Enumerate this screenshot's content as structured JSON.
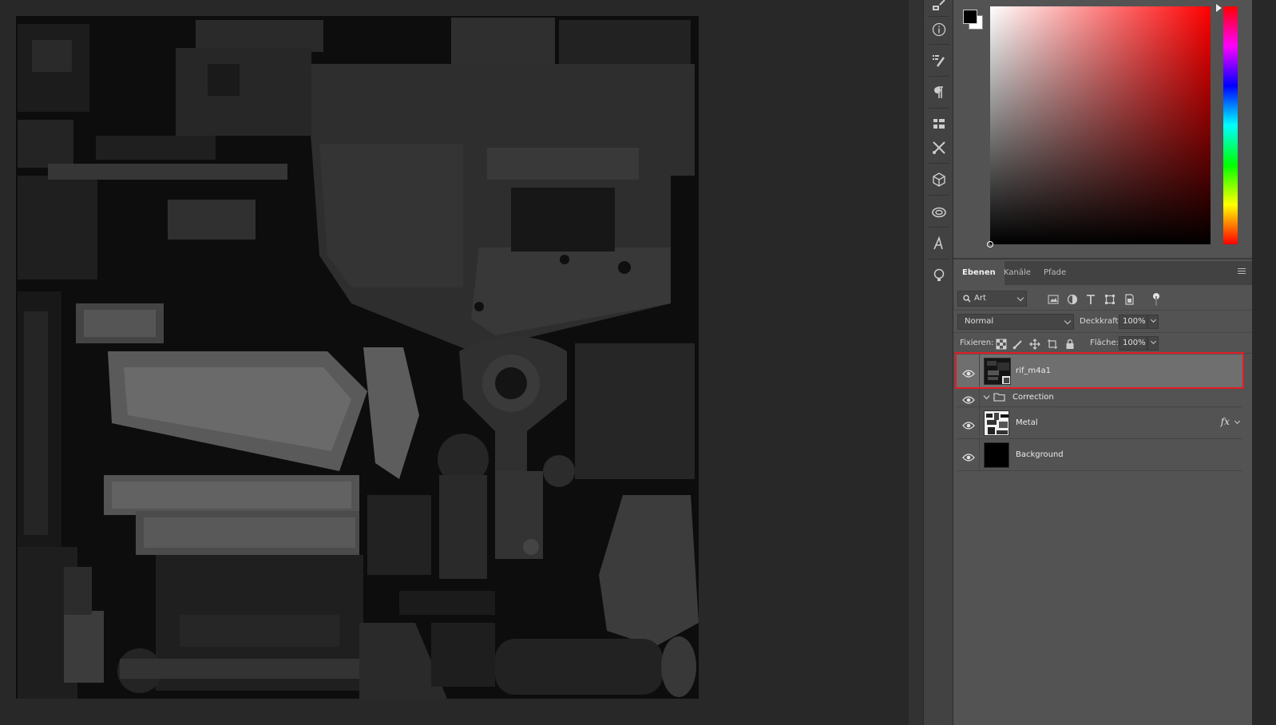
{
  "app": {
    "name": "Adobe Photoshop",
    "colors": {
      "workspace": "#282828",
      "panel": "#535353",
      "panel_dark": "#424242",
      "selected_layer": "#6f6f6f",
      "highlight_border": "#e11d25"
    }
  },
  "document": {
    "content": "rifle texture atlas (dark metal UV layout)"
  },
  "toolstrip": {
    "items": [
      {
        "name": "history-icon"
      },
      {
        "name": "info-icon"
      },
      {
        "name": "brush-presets-icon"
      },
      {
        "name": "paragraph-icon"
      },
      {
        "name": "properties-icon"
      },
      {
        "name": "tools-icon"
      },
      {
        "name": "3d-cube-icon"
      },
      {
        "name": "creative-cloud-libraries-icon"
      },
      {
        "name": "glyphs-icon"
      },
      {
        "name": "learn-icon"
      }
    ]
  },
  "color_panel": {
    "foreground": "#000000",
    "background": "#ffffff",
    "hue": "#ff0000"
  },
  "layers_panel": {
    "tabs": [
      {
        "label": "Ebenen",
        "active": true
      },
      {
        "label": "Kanäle",
        "active": false
      },
      {
        "label": "Pfade",
        "active": false
      }
    ],
    "filter": {
      "label": "Art"
    },
    "blend_mode": "Normal",
    "opacity_label": "Deckkraft:",
    "opacity_value": "100%",
    "lock_label": "Fixieren:",
    "fill_label": "Fläche:",
    "fill_value": "100%",
    "layers": [
      {
        "name": "rif_m4a1",
        "selected": true,
        "visible": true,
        "type": "smart-object"
      },
      {
        "name": "Correction",
        "selected": false,
        "visible": true,
        "type": "group",
        "expanded": true
      },
      {
        "name": "Metal",
        "selected": false,
        "visible": true,
        "type": "image",
        "effects": "fx"
      },
      {
        "name": "Background",
        "selected": false,
        "visible": true,
        "type": "fill"
      }
    ]
  }
}
